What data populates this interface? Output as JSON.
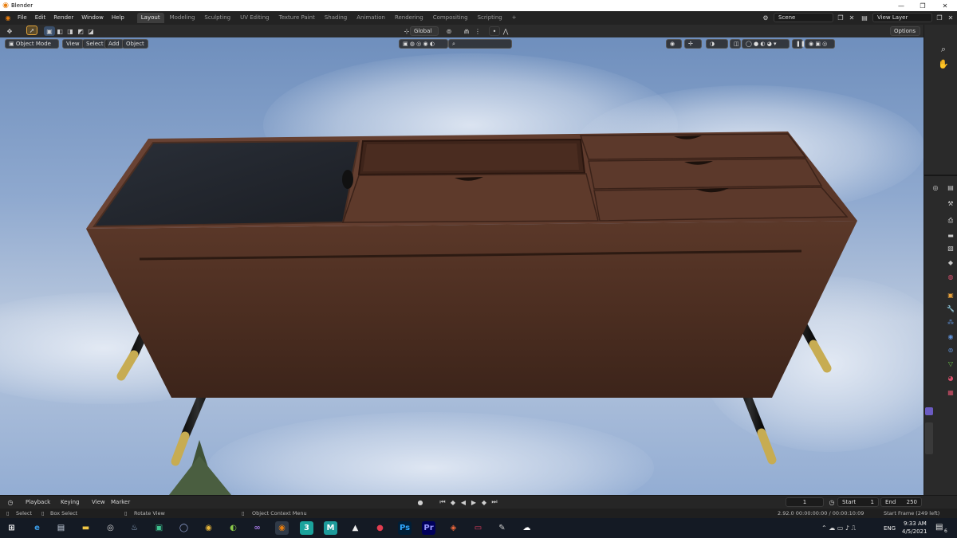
{
  "window": {
    "title": "Blender",
    "min_glyph": "—",
    "max_glyph": "❐",
    "close_glyph": "✕"
  },
  "menubar": {
    "menus": [
      "File",
      "Edit",
      "Render",
      "Window",
      "Help"
    ],
    "workspaces": [
      "Layout",
      "Modeling",
      "Sculpting",
      "UV Editing",
      "Texture Paint",
      "Shading",
      "Animation",
      "Rendering",
      "Compositing",
      "Scripting"
    ],
    "add_workspace": "+",
    "scene_label": "Scene",
    "view_layer_label": "View Layer"
  },
  "tool_header": {
    "transform_orientation": "Global",
    "options_label": "Options"
  },
  "viewport_header": {
    "mode": "Object Mode",
    "menus": [
      "View",
      "Select",
      "Add",
      "Object"
    ]
  },
  "timeline": {
    "menus": [
      "Playback",
      "Keying",
      "View",
      "Marker"
    ],
    "current_frame": "1",
    "start_label": "Start",
    "start_value": "1",
    "end_label": "End",
    "end_value": "250"
  },
  "statusbar": {
    "select": "Select",
    "box_select": "Box Select",
    "rotate_view": "Rotate View",
    "context_menu": "Object Context Menu",
    "version_info": "2.92.0  00:00:00:00 / 00:00:10:09",
    "start_frame_info": "Start Frame (249 left)"
  },
  "taskbar": {
    "language": "ENG",
    "time": "9:33 AM",
    "date": "4/5/2021",
    "notification_count": "6"
  },
  "colors": {
    "blender_orange": "#e87d0d",
    "active_tab": "#3d3d3d",
    "sky": "#8fa9cf",
    "wood": "#5a3527"
  }
}
